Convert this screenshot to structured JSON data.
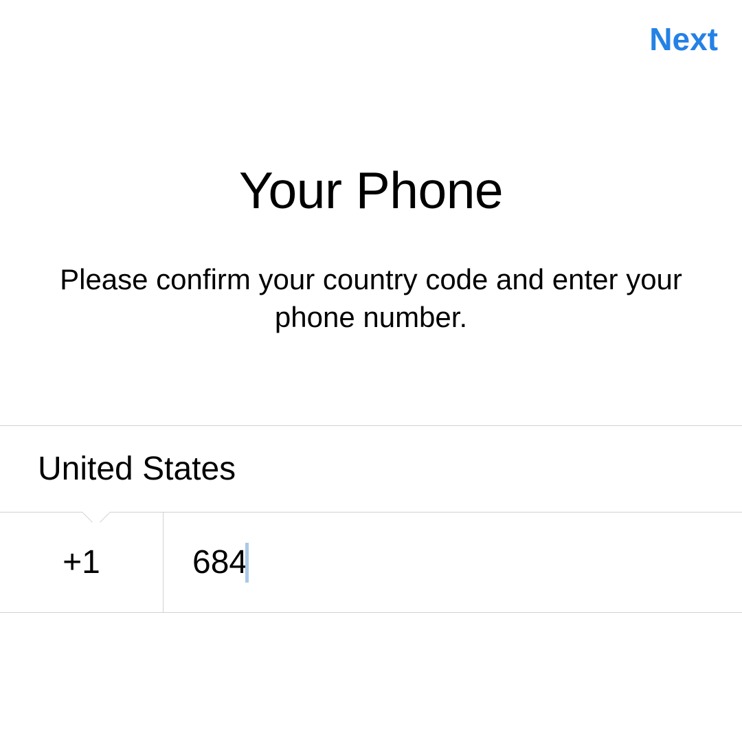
{
  "header": {
    "next_label": "Next"
  },
  "main": {
    "title": "Your Phone",
    "subtitle": "Please confirm your country code and enter your phone number."
  },
  "form": {
    "country_name": "United States",
    "country_code": "+1",
    "phone_value": "684"
  },
  "colors": {
    "accent": "#2481e5"
  }
}
